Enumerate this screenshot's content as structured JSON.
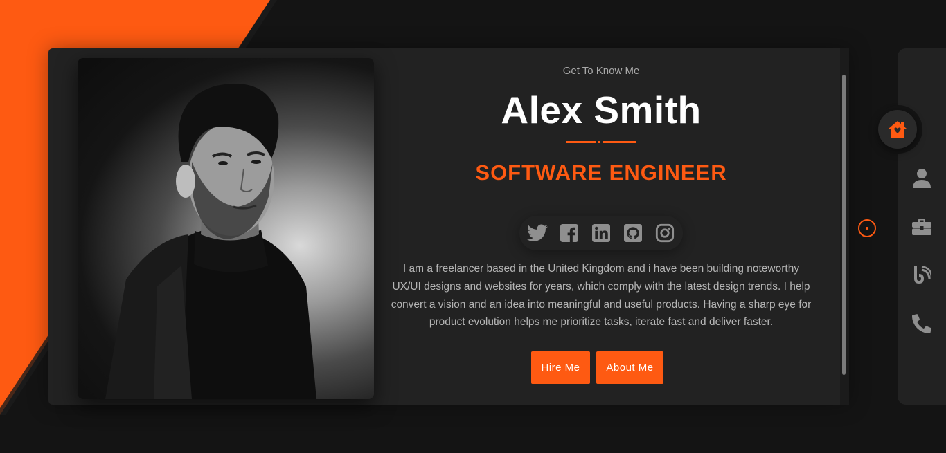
{
  "hero": {
    "eyebrow": "Get To Know Me",
    "name": "Alex Smith",
    "role": "SOFTWARE ENGINEER",
    "bio": "I am a freelancer based in the United Kingdom and i have been building noteworthy UX/UI designs and websites for years, which comply with the latest design trends. I help convert a vision and an idea into meaningful and useful products. Having a sharp eye for product evolution helps me prioritize tasks, iterate fast and deliver faster.",
    "buttons": {
      "hire": "Hire Me",
      "about": "About Me"
    }
  },
  "socials": [
    {
      "icon": "twitter-icon"
    },
    {
      "icon": "facebook-icon"
    },
    {
      "icon": "linkedin-icon"
    },
    {
      "icon": "github-icon"
    },
    {
      "icon": "instagram-icon"
    }
  ],
  "nav": {
    "active": "home",
    "items": [
      {
        "id": "home",
        "icon": "home-icon"
      },
      {
        "id": "about",
        "icon": "user-icon"
      },
      {
        "id": "portfolio",
        "icon": "briefcase-icon"
      },
      {
        "id": "blog",
        "icon": "blog-icon"
      },
      {
        "id": "contact",
        "icon": "phone-icon"
      }
    ]
  },
  "colors": {
    "accent": "#fe5a12",
    "background": "#141414",
    "card": "#222222",
    "heading": "#ffffff",
    "body_text": "#b5b5b5",
    "icon_muted": "#8f8f8f"
  }
}
